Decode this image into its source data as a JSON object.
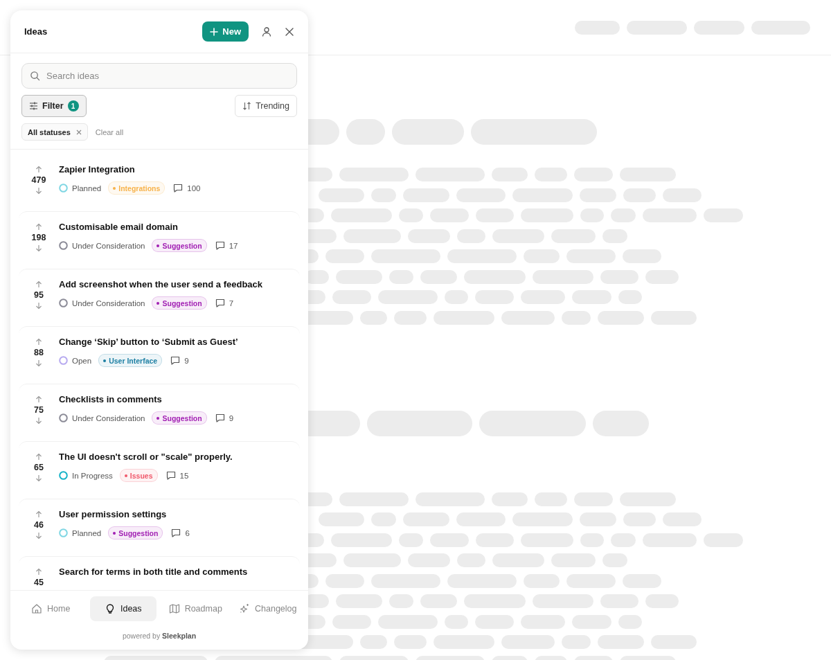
{
  "panel": {
    "title": "Ideas",
    "new_button": "New",
    "search": {
      "placeholder": "Search ideas"
    },
    "filter": {
      "label": "Filter",
      "count": "1"
    },
    "sort": {
      "label": "Trending"
    },
    "chips": [
      {
        "label": "All statuses"
      }
    ],
    "clear_all": "Clear all"
  },
  "ideas": [
    {
      "votes": "479",
      "title": "Zapier Integration",
      "status": {
        "label": "Planned",
        "kind": "ring",
        "color": "#7fd6e3"
      },
      "tag": {
        "label": "Integrations",
        "color": "#f7b24a"
      },
      "comments": "100"
    },
    {
      "votes": "198",
      "title": "Customisable email domain",
      "status": {
        "label": "Under Consideration",
        "kind": "ring",
        "color": "#8b8b97"
      },
      "tag": {
        "label": "Suggestion",
        "color": "#a11fb3"
      },
      "comments": "17"
    },
    {
      "votes": "95",
      "title": "Add screenshot when the user send a feedback",
      "status": {
        "label": "Under Consideration",
        "kind": "ring",
        "color": "#8b8b97"
      },
      "tag": {
        "label": "Suggestion",
        "color": "#a11fb3"
      },
      "comments": "7"
    },
    {
      "votes": "88",
      "title": "Change ‘Skip’ button to ‘Submit as Guest’",
      "status": {
        "label": "Open",
        "kind": "ring",
        "color": "#b7aaf0"
      },
      "tag": {
        "label": "User Interface",
        "color": "#1c7fa3"
      },
      "comments": "9"
    },
    {
      "votes": "75",
      "title": "Checklists in comments",
      "status": {
        "label": "Under Consideration",
        "kind": "ring",
        "color": "#8b8b97"
      },
      "tag": {
        "label": "Suggestion",
        "color": "#a11fb3"
      },
      "comments": "9"
    },
    {
      "votes": "65",
      "title": "The UI doesn't scroll or \"scale\" properly.",
      "status": {
        "label": "In Progress",
        "kind": "ring",
        "color": "#17b3c8"
      },
      "tag": {
        "label": "Issues",
        "color": "#f0596b"
      },
      "comments": "15"
    },
    {
      "votes": "46",
      "title": "User permission settings",
      "status": {
        "label": "Planned",
        "kind": "ring",
        "color": "#7fd6e3"
      },
      "tag": {
        "label": "Suggestion",
        "color": "#a11fb3"
      },
      "comments": "6"
    },
    {
      "votes": "45",
      "title": "Search for terms in both title and comments"
    }
  ],
  "nav": [
    {
      "label": "Home",
      "kind": "home",
      "selected": false
    },
    {
      "label": "Ideas",
      "kind": "bulb",
      "selected": true
    },
    {
      "label": "Roadmap",
      "kind": "map",
      "selected": false
    },
    {
      "label": "Changelog",
      "kind": "sparkle",
      "selected": false
    }
  ],
  "footer": "powered by **Sleekplan**"
}
